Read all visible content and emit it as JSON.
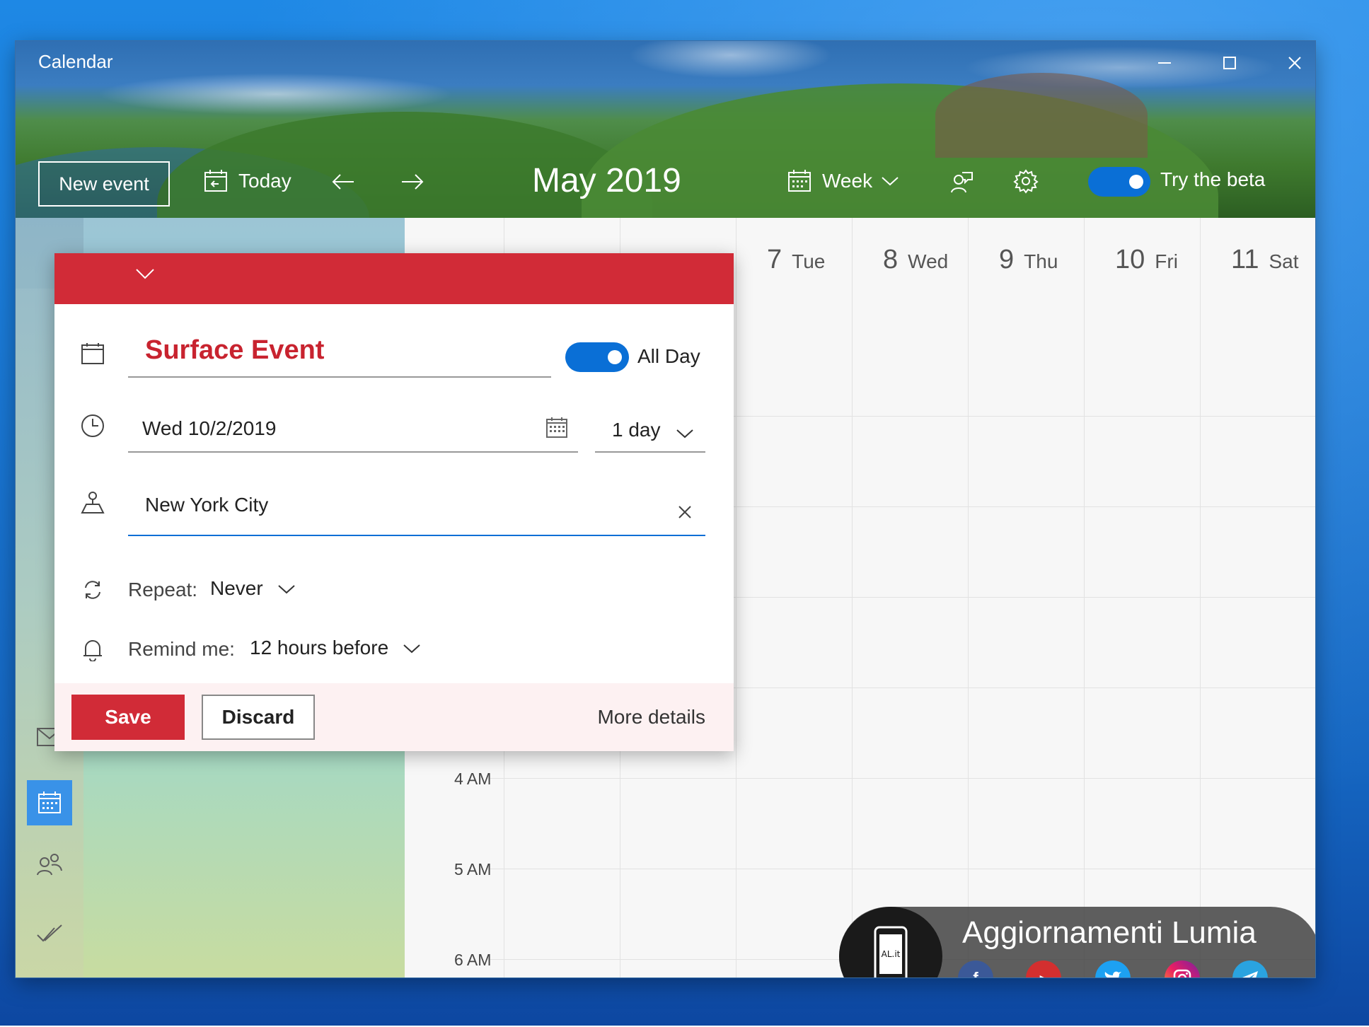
{
  "window": {
    "title": "Calendar"
  },
  "toolbar": {
    "new_event": "New event",
    "today": "Today",
    "month_title": "May 2019",
    "view": "Week",
    "beta_label": "Try the beta"
  },
  "days": [
    {
      "num": "7",
      "name": "Tue"
    },
    {
      "num": "8",
      "name": "Wed"
    },
    {
      "num": "9",
      "name": "Thu"
    },
    {
      "num": "10",
      "name": "Fri"
    },
    {
      "num": "11",
      "name": "Sat"
    }
  ],
  "times": [
    "4 AM",
    "5 AM",
    "6 AM"
  ],
  "event_form": {
    "title": "Surface Event",
    "all_day_label": "All Day",
    "date": "Wed 10/2/2019",
    "duration": "1 day",
    "location": "New York City",
    "repeat_label": "Repeat:",
    "repeat_value": "Never",
    "remind_label": "Remind me:",
    "remind_value": "12 hours before",
    "save": "Save",
    "discard": "Discard",
    "more_details": "More details"
  },
  "watermark": {
    "title": "Aggiornamenti Lumia",
    "logo_text": "AL.it"
  },
  "colors": {
    "accent_red": "#d12b37",
    "toggle_blue": "#0a6fd6"
  }
}
